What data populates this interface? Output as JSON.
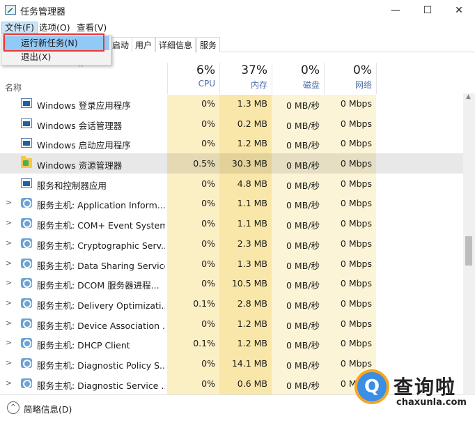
{
  "window": {
    "title": "任务管理器",
    "minimize": "—",
    "maximize": "☐",
    "close": "✕"
  },
  "menu": [
    "文件(F)",
    "选项(O)",
    "查看(V)"
  ],
  "dropdown": {
    "items": [
      "运行新任务(N)",
      "退出(X)"
    ]
  },
  "tabs": [
    "启动",
    "用户",
    "详细信息",
    "服务"
  ],
  "columns": {
    "name_label": "名称",
    "cpu": {
      "pct": "6%",
      "label": "CPU"
    },
    "memory": {
      "pct": "37%",
      "label": "内存"
    },
    "disk": {
      "pct": "0%",
      "label": "磁盘"
    },
    "network": {
      "pct": "0%",
      "label": "网络"
    }
  },
  "processes": [
    {
      "name": "Windows 登录应用程序",
      "icon": "window-icon",
      "expandable": false,
      "cpu": "0%",
      "mem": "1.3 MB",
      "disk": "0 MB/秒",
      "net": "0 Mbps"
    },
    {
      "name": "Windows 会话管理器",
      "icon": "window-icon",
      "expandable": false,
      "cpu": "0%",
      "mem": "0.2 MB",
      "disk": "0 MB/秒",
      "net": "0 Mbps"
    },
    {
      "name": "Windows 启动应用程序",
      "icon": "window-icon",
      "expandable": false,
      "cpu": "0%",
      "mem": "1.2 MB",
      "disk": "0 MB/秒",
      "net": "0 Mbps"
    },
    {
      "name": "Windows 资源管理器",
      "icon": "folder-icon",
      "expandable": false,
      "selected": true,
      "cpu": "0.5%",
      "mem": "30.3 MB",
      "disk": "0 MB/秒",
      "net": "0 Mbps"
    },
    {
      "name": "服务和控制器应用",
      "icon": "window-icon",
      "expandable": false,
      "cpu": "0%",
      "mem": "4.8 MB",
      "disk": "0 MB/秒",
      "net": "0 Mbps"
    },
    {
      "name": "服务主机: Application Inform...",
      "icon": "gear-icon",
      "expandable": true,
      "cpu": "0%",
      "mem": "1.1 MB",
      "disk": "0 MB/秒",
      "net": "0 Mbps"
    },
    {
      "name": "服务主机: COM+ Event System",
      "icon": "gear-icon",
      "expandable": true,
      "cpu": "0%",
      "mem": "1.1 MB",
      "disk": "0 MB/秒",
      "net": "0 Mbps"
    },
    {
      "name": "服务主机: Cryptographic Serv...",
      "icon": "gear-icon",
      "expandable": true,
      "cpu": "0%",
      "mem": "2.3 MB",
      "disk": "0 MB/秒",
      "net": "0 Mbps"
    },
    {
      "name": "服务主机: Data Sharing Service",
      "icon": "gear-icon",
      "expandable": true,
      "cpu": "0%",
      "mem": "1.3 MB",
      "disk": "0 MB/秒",
      "net": "0 Mbps"
    },
    {
      "name": "服务主机: DCOM 服务器进程...",
      "icon": "gear-icon",
      "expandable": true,
      "cpu": "0%",
      "mem": "10.5 MB",
      "disk": "0 MB/秒",
      "net": "0 Mbps"
    },
    {
      "name": "服务主机: Delivery Optimizati...",
      "icon": "gear-icon",
      "expandable": true,
      "cpu": "0.1%",
      "mem": "2.8 MB",
      "disk": "0 MB/秒",
      "net": "0 Mbps"
    },
    {
      "name": "服务主机: Device Association ...",
      "icon": "gear-icon",
      "expandable": true,
      "cpu": "0%",
      "mem": "1.2 MB",
      "disk": "0 MB/秒",
      "net": "0 Mbps"
    },
    {
      "name": "服务主机: DHCP Client",
      "icon": "gear-icon",
      "expandable": true,
      "cpu": "0.1%",
      "mem": "1.2 MB",
      "disk": "0 MB/秒",
      "net": "0 Mbps"
    },
    {
      "name": "服务主机: Diagnostic Policy S...",
      "icon": "gear-icon",
      "expandable": true,
      "cpu": "0%",
      "mem": "14.1 MB",
      "disk": "0 MB/秒",
      "net": "0 Mbps"
    },
    {
      "name": "服务主机: Diagnostic Service ...",
      "icon": "gear-icon",
      "expandable": true,
      "cpu": "0%",
      "mem": "0.6 MB",
      "disk": "0 MB/秒",
      "net": "0 Mbps"
    }
  ],
  "footer": {
    "label": "简略信息(D)",
    "icon": "chevron-up-circle-icon"
  },
  "watermark": {
    "cn": "查询啦",
    "en": "chaxunla.com",
    "logo_letter": "Q"
  },
  "colors": {
    "cpu_col_bg": "#fbefc4",
    "mem_col_bg": "#f9e7a9",
    "other_col_bg": "#fcf4d6",
    "header_label": "#4d6fa8",
    "menu_highlight": "#91c9f7",
    "red_frame": "#e53935"
  }
}
